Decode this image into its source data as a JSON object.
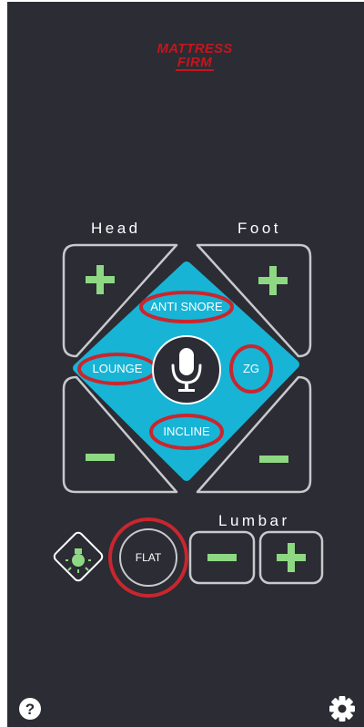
{
  "brand": {
    "line1": "MATTRESS",
    "line2": "FIRM"
  },
  "labels": {
    "head": "Head",
    "foot": "Foot",
    "lumbar": "Lumbar"
  },
  "presets": {
    "anti_snore": "ANTI SNORE",
    "lounge": "LOUNGE",
    "zg": "ZG",
    "incline": "INCLINE",
    "flat": "FLAT"
  },
  "icons": {
    "head_up": "plus-icon",
    "head_down": "minus-icon",
    "foot_up": "plus-icon",
    "foot_down": "minus-icon",
    "mic": "microphone-icon",
    "light": "light-bulb-icon",
    "lumbar_down": "minus-icon",
    "lumbar_up": "plus-icon",
    "help": "question-icon",
    "settings": "gear-icon"
  },
  "colors": {
    "background": "#2b2c34",
    "accent": "#17b4d6",
    "green": "#8fd883",
    "highlight": "#c9262e",
    "outline": "#c8c9cc"
  }
}
